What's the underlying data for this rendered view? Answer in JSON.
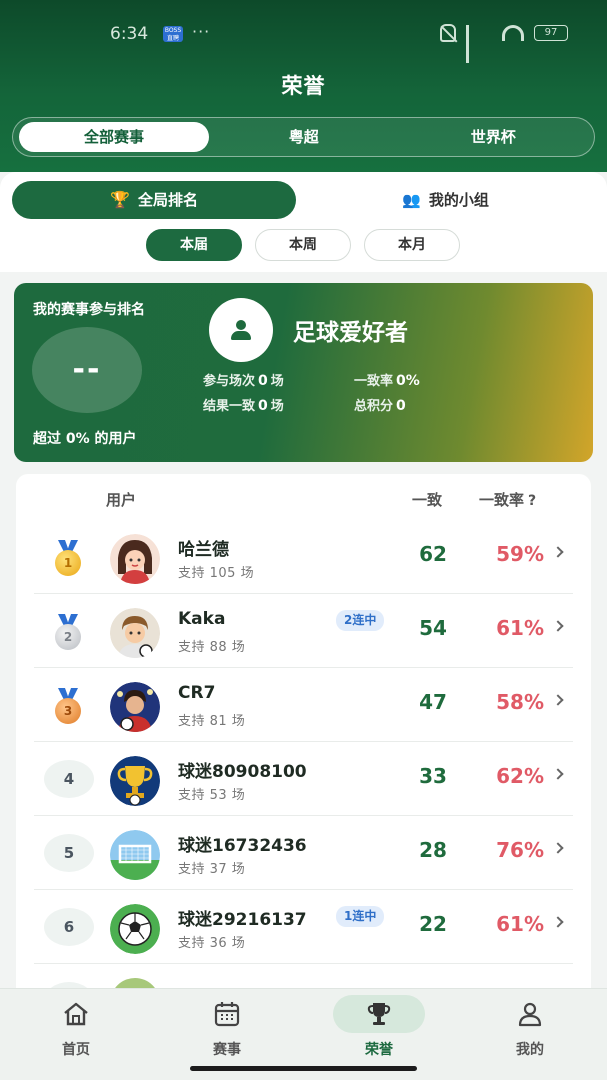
{
  "status_bar": {
    "time": "6:34",
    "app_badge": "BOSS 直聘",
    "dots": "···",
    "battery": "97"
  },
  "page": {
    "title": "荣誉"
  },
  "league_tabs": [
    {
      "label": "全部赛事",
      "active": true
    },
    {
      "label": "粤超",
      "active": false
    },
    {
      "label": "世界杯",
      "active": false
    }
  ],
  "scope_tabs": [
    {
      "label": "全局排名",
      "icon": "trophy-icon",
      "active": true
    },
    {
      "label": "我的小组",
      "icon": "group-icon",
      "active": false
    }
  ],
  "period_tabs": [
    {
      "label": "本届",
      "active": true
    },
    {
      "label": "本周",
      "active": false
    },
    {
      "label": "本月",
      "active": false
    }
  ],
  "my_card": {
    "title": "我的赛事参与排名",
    "rank": "--",
    "exceed_text": "超过 0% 的用户",
    "nickname": "足球爱好者",
    "participate_label": "参与场次",
    "participate_value": "0",
    "participate_unit": "场",
    "rate_label": "一致率",
    "rate_value": "0%",
    "result_label": "结果一致",
    "result_value": "0",
    "result_unit": "场",
    "points_label": "总积分",
    "points_value": "0"
  },
  "board": {
    "head_user": "用户",
    "head_match": "一致",
    "head_rate": "一致率",
    "help_glyph": "?",
    "rows": [
      {
        "rank": "1",
        "medal": "gold",
        "name": "哈兰德",
        "support": "支持 105 场",
        "streak": "",
        "match": "62",
        "rate": "59%"
      },
      {
        "rank": "2",
        "medal": "silver",
        "name": "Kaka",
        "support": "支持 88 场",
        "streak": "2连中",
        "match": "54",
        "rate": "61%"
      },
      {
        "rank": "3",
        "medal": "bronze",
        "name": "CR7",
        "support": "支持 81 场",
        "streak": "",
        "match": "47",
        "rate": "58%"
      },
      {
        "rank": "4",
        "medal": "",
        "name": "球迷80908100",
        "support": "支持 53 场",
        "streak": "",
        "match": "33",
        "rate": "62%"
      },
      {
        "rank": "5",
        "medal": "",
        "name": "球迷16732436",
        "support": "支持 37 场",
        "streak": "",
        "match": "28",
        "rate": "76%"
      },
      {
        "rank": "6",
        "medal": "",
        "name": "球迷29216137",
        "support": "支持 36 场",
        "streak": "1连中",
        "match": "22",
        "rate": "61%"
      }
    ]
  },
  "bottom_nav": [
    {
      "label": "首页",
      "icon": "home-icon",
      "active": false
    },
    {
      "label": "赛事",
      "icon": "calendar-icon",
      "active": false
    },
    {
      "label": "荣誉",
      "icon": "trophy-icon",
      "active": true
    },
    {
      "label": "我的",
      "icon": "profile-icon",
      "active": false
    }
  ],
  "colors": {
    "primary_green": "#1d6a40",
    "rate_red": "#e05a66",
    "streak_blue": "#2f6fc8"
  }
}
